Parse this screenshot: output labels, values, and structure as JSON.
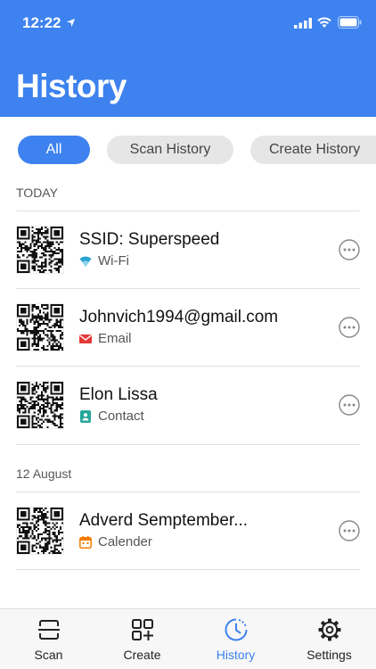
{
  "status": {
    "time": "12:22"
  },
  "header": {
    "title": "History"
  },
  "filters": {
    "all": "All",
    "scan": "Scan History",
    "create": "Create History"
  },
  "sections": [
    {
      "label": "TODAY",
      "items": [
        {
          "title": "SSID: Superspeed",
          "type": "Wi-Fi",
          "icon": "wifi-icon",
          "color": "#2aa4d4"
        },
        {
          "title": "Johnvich1994@gmail.com",
          "type": "Email",
          "icon": "mail-icon",
          "color": "#e53935"
        },
        {
          "title": "Elon Lissa",
          "type": "Contact",
          "icon": "contact-icon",
          "color": "#26a69a"
        }
      ]
    },
    {
      "label": "12 August",
      "items": [
        {
          "title": "Adverd Semptember...",
          "type": "Calender",
          "icon": "calendar-icon",
          "color": "#f57c00"
        }
      ]
    }
  ],
  "tabs": {
    "scan": "Scan",
    "create": "Create",
    "history": "History",
    "settings": "Settings"
  },
  "colors": {
    "accent": "#3d82ee",
    "chip_inactive": "#e6e6e6"
  }
}
